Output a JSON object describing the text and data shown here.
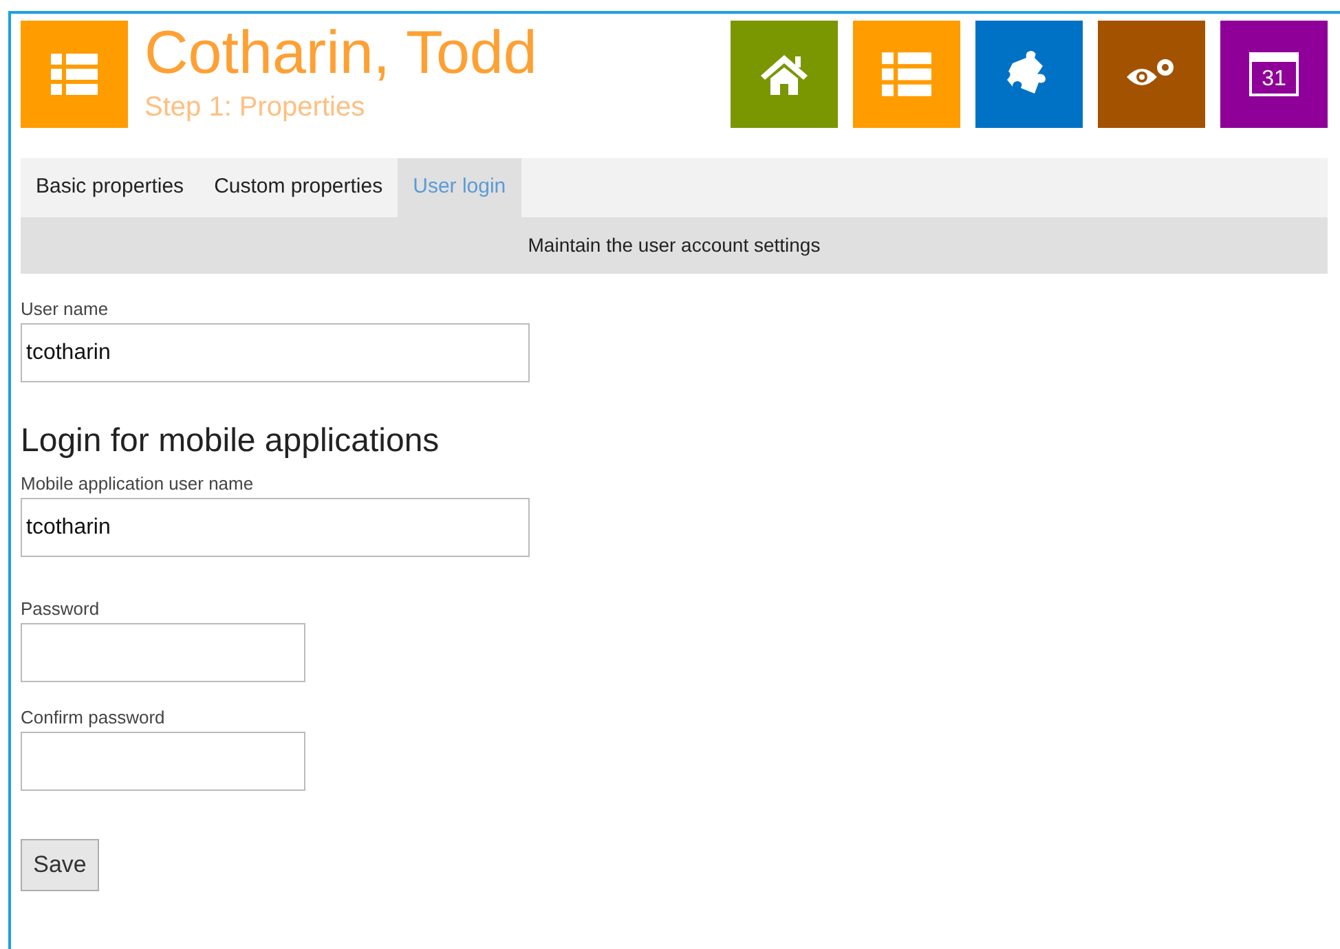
{
  "header": {
    "title": "Cotharin, Todd",
    "subtitle": "Step 1: Properties"
  },
  "nav_tiles": [
    {
      "kind": "home",
      "color": "#7a9600"
    },
    {
      "kind": "list",
      "color": "#ff9c00"
    },
    {
      "kind": "puzzle",
      "color": "#0072c6"
    },
    {
      "kind": "eye",
      "color": "#a35200"
    },
    {
      "kind": "calendar",
      "color": "#8f0099",
      "text": "31"
    }
  ],
  "tabs": [
    {
      "label": "Basic properties",
      "selected": false
    },
    {
      "label": "Custom properties",
      "selected": false
    },
    {
      "label": "User login",
      "selected": true
    }
  ],
  "banner": "Maintain the user account settings",
  "form": [
    {
      "kind": "text",
      "label": "User name",
      "value": "tcotharin"
    },
    {
      "kind": "heading",
      "text": "Login for mobile applications"
    },
    {
      "kind": "text",
      "label": "Mobile application user name",
      "value": "tcotharin"
    },
    {
      "kind": "password",
      "label": "Password"
    },
    {
      "kind": "password",
      "label": "Confirm password"
    }
  ],
  "save_button": "Save"
}
